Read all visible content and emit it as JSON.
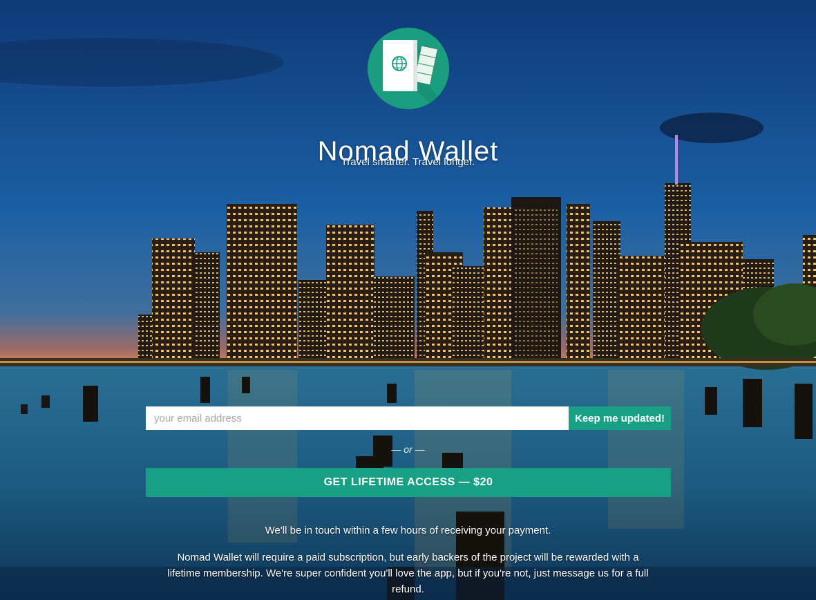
{
  "brand": {
    "name": "Nomad Wallet",
    "tagline": "Travel smarter. Travel longer.",
    "logo_icon": "passport-wallet-icon",
    "accent_color": "#18a085"
  },
  "signup": {
    "email_placeholder": "your email address",
    "email_value": "",
    "submit_label": "Keep me updated!"
  },
  "divider_text": "— or —",
  "purchase": {
    "cta_label": "GET LIFETIME ACCESS — $20"
  },
  "info": {
    "notice": "We'll be in touch within a few hours of receiving your payment.",
    "description": "Nomad Wallet will require a paid subscription, but early backers of the project will be rewarded with a lifetime membership. We're super confident you'll love the app, but if you're not, just message us for a full refund."
  },
  "background": {
    "icon": "city-skyline-night-photo"
  }
}
